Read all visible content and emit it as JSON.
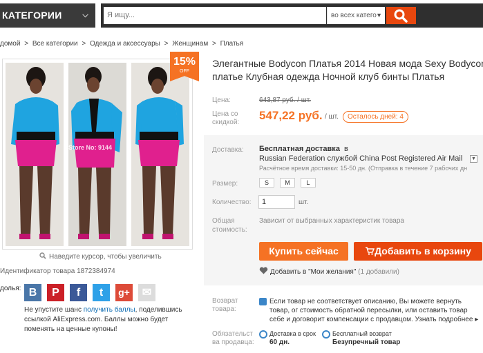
{
  "header": {
    "category_label": "КАТЕГОРИИ",
    "search_placeholder": "Я ищу...",
    "search_scope": "во всех катего",
    "colors": {
      "dark": "#2f2f2f",
      "accent": "#e8470e"
    }
  },
  "breadcrumbs": [
    "домой",
    ">",
    "Все категории",
    ">",
    "Одежда и аксессуары",
    ">",
    "Женщинам",
    ">",
    "Платья"
  ],
  "gallery": {
    "watermark": "Store No: 9144",
    "discount_pct": "15%",
    "discount_off": "OFF",
    "zoom_hint": "Наведите курсор, чтобы увеличить",
    "product_id_label": "Идентификатор товара",
    "product_id": "1872384974"
  },
  "share": {
    "label": "долья:",
    "networks": [
      {
        "icon": "vk-icon",
        "glyph": "B",
        "color": "#4a76a8"
      },
      {
        "icon": "pinterest-icon",
        "glyph": "P",
        "color": "#cb2027"
      },
      {
        "icon": "facebook-icon",
        "glyph": "f",
        "color": "#3b5998"
      },
      {
        "icon": "twitter-icon",
        "glyph": "t",
        "color": "#2ea1e8"
      },
      {
        "icon": "google-plus-icon",
        "glyph": "g+",
        "color": "#dd4b39"
      },
      {
        "icon": "email-icon",
        "glyph": "✉",
        "color": "#dcdcdc"
      }
    ],
    "text_before": "Не упустите шанс ",
    "link": "получить баллы",
    "text_after": ", поделившись ссылкой AliExpress.com. Баллы можно будет поменять на ценные купоны!"
  },
  "product": {
    "title_line1": "Элегантные Bodycon Платья 2014 Новая мода Sexy Bodycon",
    "title_line2": "платье Клубная одежда Ночной клуб бинты Платья",
    "price_label": "Цена:",
    "old_price": "643,87 руб. / шт.",
    "discount_label_1": "Цена со",
    "discount_label_2": "скидкой:",
    "new_price": "547,22 руб.",
    "per_unit": "/ шт.",
    "days_left": "Осталось дней: 4"
  },
  "shipping": {
    "label": "Доставка:",
    "free": "Бесплатная доставка",
    "in": "в",
    "method": "Russian Federation службой China Post Registered Air Mail",
    "time": "Расчётное время доставки: 15-50 дн. (Отправка в течение 7 рабочих дн"
  },
  "options": {
    "size_label": "Размер:",
    "sizes": [
      "S",
      "M",
      "L"
    ],
    "qty_label": "Количество:",
    "qty_value": "1",
    "qty_unit": "шт.",
    "total_label_1": "Общая",
    "total_label_2": "стоимость:",
    "total_text": "Зависит от выбранных характеристик товара"
  },
  "actions": {
    "buy": "Купить сейчас",
    "cart": "Добавить в корзину",
    "wish": "Добавить в \"Мои желания\"",
    "wish_count": "(1 добавили)"
  },
  "returns": {
    "label_1": "Возврат",
    "label_2": "товара:",
    "text": "Если товар не соответствует описанию, Вы можете вернуть товар, ог стоимость обратной пересылки, или оставить товар себе и договорит компенсации с продавцом.",
    "more": "Узнать подробнее ▸"
  },
  "guarantees": {
    "label_1": "Обязательст",
    "label_2": "ва продавца:",
    "delivery_title": "Доставка в срок",
    "delivery_value": "60 дн.",
    "return_title": "Бесплатный возврат",
    "return_value": "Безупречный товар"
  }
}
